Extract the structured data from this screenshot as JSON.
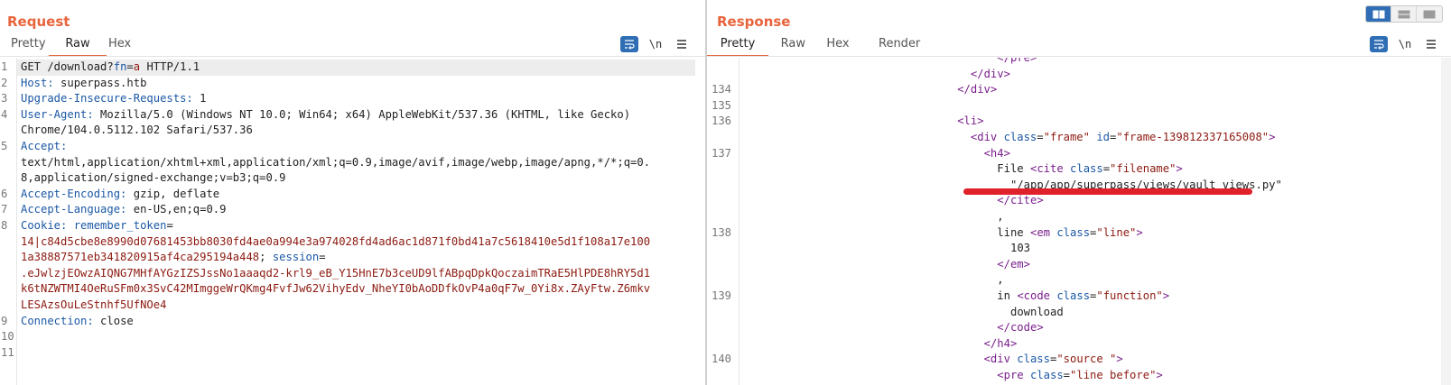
{
  "request": {
    "title": "Request",
    "tabs": [
      "Pretty",
      "Raw",
      "Hex"
    ],
    "active_tab": "Raw",
    "tools": {
      "wrap_icon": "wrap-lines-icon",
      "newline_label": "\\n",
      "menu_icon": "menu-icon"
    },
    "lines": [
      {
        "n": "1",
        "k": "GET /download?",
        "kc": "plain",
        "v": "fn",
        "vc": "hk",
        "r": "=",
        "rc": "plain",
        "s": "a",
        "sc": "cv",
        "t": " HTTP/1.1",
        "tc": "plain"
      },
      {
        "n": "2",
        "k": "Host:",
        "kc": "hk",
        "v": " superpass.htb",
        "vc": "hv"
      },
      {
        "n": "3",
        "k": "Upgrade-Insecure-Requests:",
        "kc": "hk",
        "v": " 1",
        "vc": "hv"
      },
      {
        "n": "4",
        "k": "User-Agent:",
        "kc": "hk",
        "v": " Mozilla/5.0 (Windows NT 10.0; Win64; x64) AppleWebKit/537.36 (KHTML, like Gecko)",
        "vc": "hv"
      },
      {
        "n": "",
        "k": "",
        "kc": "hv",
        "v": "Chrome/104.0.5112.102 Safari/537.36",
        "vc": "hv"
      },
      {
        "n": "5",
        "k": "Accept:",
        "kc": "hk",
        "v": "",
        "vc": "hv"
      },
      {
        "n": "",
        "k": "",
        "kc": "hv",
        "v": "text/html,application/xhtml+xml,application/xml;q=0.9,image/avif,image/webp,image/apng,*/*;q=0.",
        "vc": "hv"
      },
      {
        "n": "",
        "k": "",
        "kc": "hv",
        "v": "8,application/signed-exchange;v=b3;q=0.9",
        "vc": "hv"
      },
      {
        "n": "6",
        "k": "Accept-Encoding:",
        "kc": "hk",
        "v": " gzip, deflate",
        "vc": "hv"
      },
      {
        "n": "7",
        "k": "Accept-Language:",
        "kc": "hk",
        "v": " en-US,en;q=0.9",
        "vc": "hv"
      },
      {
        "n": "8",
        "k": "Cookie:",
        "kc": "hk",
        "v": " remember_token",
        "vc": "hk",
        "r": "=",
        "rc": "plain"
      },
      {
        "n": "",
        "k": "",
        "kc": "cv",
        "v": "14|c84d5cbe8e8990d07681453bb8030fd4ae0a994e3a974028fd4ad6ac1d871f0bd41a7c5618410e5d1f108a17e100",
        "vc": "cv"
      },
      {
        "n": "",
        "k": "",
        "kc": "cv",
        "v": "1a38887571eb341820915af4ca295194a448",
        "vc": "cv",
        "r": "; ",
        "rc": "plain",
        "s": "session",
        "sc": "hk",
        "t": "=",
        "tc": "plain"
      },
      {
        "n": "",
        "k": "",
        "kc": "cv",
        "v": ".eJwlzjEOwzAIQNG7MHfAYGzIZSJssNo1aaaqd2-krl9_eB_Y15HnE7b3ceUD9lfABpqDpkQoczaimTRaE5HlPDE8hRY5d1",
        "vc": "cv"
      },
      {
        "n": "",
        "k": "",
        "kc": "cv",
        "v": "k6tNZWTMI4OeRuSFm0x3SvC42MImggeWrQKmg4FvfJw62VihyEdv_NheYI0bAoDDfkOvP4a0qF7w_0Yi8x.ZAyFtw.Z6mkv",
        "vc": "cv"
      },
      {
        "n": "",
        "k": "",
        "kc": "cv",
        "v": "LESAzsOuLeStnhf5UfNOe4",
        "vc": "cv"
      },
      {
        "n": "9",
        "k": "Connection:",
        "kc": "hk",
        "v": " close",
        "vc": "hv"
      },
      {
        "n": "10",
        "k": "",
        "kc": "hv",
        "v": "",
        "vc": "hv"
      },
      {
        "n": "11",
        "k": "",
        "kc": "hv",
        "v": "",
        "vc": "hv"
      }
    ]
  },
  "response": {
    "title": "Response",
    "tabs": [
      "Pretty",
      "Raw",
      "Hex",
      "Render"
    ],
    "active_tab": "Pretty",
    "tools": {
      "wrap_icon": "wrap-lines-icon",
      "newline_label": "\\n",
      "menu_icon": "menu-icon"
    },
    "layout_icons": [
      "split-horizontal-icon",
      "split-vertical-icon",
      "tabs-icon"
    ],
    "lines": [
      {
        "n": "",
        "i": 38,
        "parts": [
          [
            "</",
            "tag"
          ],
          [
            "pre",
            "tag"
          ],
          [
            ">",
            "tag"
          ]
        ]
      },
      {
        "n": "",
        "i": 34,
        "parts": [
          [
            "</div>",
            "tag"
          ]
        ]
      },
      {
        "n": "134",
        "i": 32,
        "parts": [
          [
            "</div>",
            "tag"
          ]
        ]
      },
      {
        "n": "135",
        "i": 0,
        "parts": []
      },
      {
        "n": "136",
        "i": 32,
        "parts": [
          [
            "<li>",
            "tag"
          ]
        ]
      },
      {
        "n": "",
        "i": 34,
        "parts": [
          [
            "<div ",
            "tag"
          ],
          [
            "class",
            "attr"
          ],
          [
            "=",
            "plain"
          ],
          [
            "\"frame\"",
            "aval"
          ],
          [
            " ",
            "plain"
          ],
          [
            "id",
            "attr"
          ],
          [
            "=",
            "plain"
          ],
          [
            "\"frame-139812337165008\"",
            "aval"
          ],
          [
            ">",
            "tag"
          ]
        ]
      },
      {
        "n": "137",
        "i": 36,
        "parts": [
          [
            "<h4>",
            "tag"
          ]
        ]
      },
      {
        "n": "",
        "i": 38,
        "parts": [
          [
            "File ",
            "plain"
          ],
          [
            "<cite ",
            "tag"
          ],
          [
            "class",
            "attr"
          ],
          [
            "=",
            "plain"
          ],
          [
            "\"filename\"",
            "aval"
          ],
          [
            ">",
            "tag"
          ]
        ]
      },
      {
        "n": "",
        "i": 40,
        "parts": [
          [
            "\"/app/app/superpass/views/vault_views.py\"",
            "plain"
          ]
        ]
      },
      {
        "n": "",
        "i": 38,
        "parts": [
          [
            "</cite>",
            "tag"
          ]
        ]
      },
      {
        "n": "",
        "i": 38,
        "parts": [
          [
            ",",
            "plain"
          ]
        ]
      },
      {
        "n": "138",
        "i": 38,
        "parts": [
          [
            "line ",
            "plain"
          ],
          [
            "<em ",
            "tag"
          ],
          [
            "class",
            "attr"
          ],
          [
            "=",
            "plain"
          ],
          [
            "\"line\"",
            "aval"
          ],
          [
            ">",
            "tag"
          ]
        ]
      },
      {
        "n": "",
        "i": 40,
        "parts": [
          [
            "103",
            "plain"
          ]
        ]
      },
      {
        "n": "",
        "i": 38,
        "parts": [
          [
            "</em>",
            "tag"
          ]
        ]
      },
      {
        "n": "",
        "i": 38,
        "parts": [
          [
            ",",
            "plain"
          ]
        ]
      },
      {
        "n": "139",
        "i": 38,
        "parts": [
          [
            "in ",
            "plain"
          ],
          [
            "<code ",
            "tag"
          ],
          [
            "class",
            "attr"
          ],
          [
            "=",
            "plain"
          ],
          [
            "\"function\"",
            "aval"
          ],
          [
            ">",
            "tag"
          ]
        ]
      },
      {
        "n": "",
        "i": 40,
        "parts": [
          [
            "download",
            "plain"
          ]
        ]
      },
      {
        "n": "",
        "i": 38,
        "parts": [
          [
            "</code>",
            "tag"
          ]
        ]
      },
      {
        "n": "",
        "i": 36,
        "parts": [
          [
            "</h4>",
            "tag"
          ]
        ]
      },
      {
        "n": "140",
        "i": 36,
        "parts": [
          [
            "<div ",
            "tag"
          ],
          [
            "class",
            "attr"
          ],
          [
            "=",
            "plain"
          ],
          [
            "\"source \"",
            "aval"
          ],
          [
            ">",
            "tag"
          ]
        ]
      },
      {
        "n": "",
        "i": 38,
        "parts": [
          [
            "<pre ",
            "tag"
          ],
          [
            "class",
            "attr"
          ],
          [
            "=",
            "plain"
          ],
          [
            "\"line before\"",
            "aval"
          ],
          [
            ">",
            "tag"
          ]
        ]
      }
    ]
  }
}
